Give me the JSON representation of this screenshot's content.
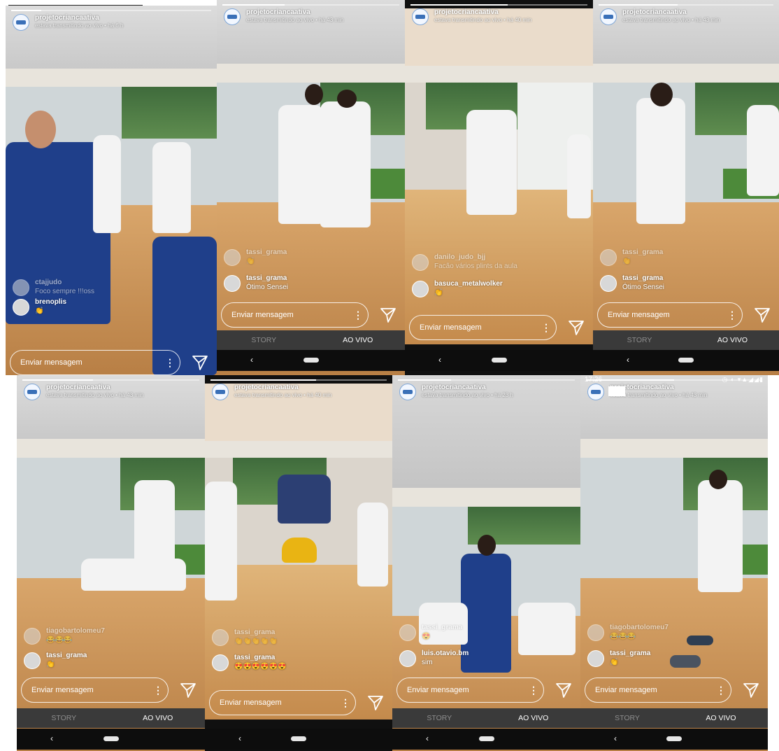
{
  "panels": [
    {
      "username": "projetocriancaativa",
      "status": "estava transmitindo ao vivo • há 6 h",
      "progress": 0.15,
      "comments": [
        {
          "user": "ctajjudo",
          "text": "Foco sempre !!!oss",
          "faded": true
        },
        {
          "user": "brenoplis",
          "text": "👏",
          "faded": false
        }
      ],
      "placeholder": "Enviar mensagem",
      "has_tabs": false
    },
    {
      "username": "projetocriancaativa",
      "status": "estava transmitindo ao vivo • há 43 min",
      "progress": 0.35,
      "comments": [
        {
          "user": "tassi_grama",
          "text": "👏",
          "faded": true
        },
        {
          "user": "tassi_grama",
          "text": "Ótimo Sensei",
          "faded": false
        }
      ],
      "placeholder": "Enviar mensagem",
      "has_tabs": true,
      "tab_story": "STORY",
      "tab_live": "AO VIVO"
    },
    {
      "username": "projetocriancaativa",
      "status": "estava transmitindo ao vivo • há 40 min",
      "progress": 0.55,
      "comments": [
        {
          "user": "danilo_judo_bjj",
          "text": "Facão vários plints da aula",
          "faded": true
        },
        {
          "user": "basuca_metalwolker",
          "text": "👏",
          "faded": false
        }
      ],
      "placeholder": "Enviar mensagem",
      "has_tabs": false
    },
    {
      "username": "projetocriancaativa",
      "status": "estava transmitindo ao vivo • há 43 min",
      "progress": 0.45,
      "comments": [
        {
          "user": "tassi_grama",
          "text": "👏",
          "faded": true
        },
        {
          "user": "tassi_grama",
          "text": "Ótimo Sensei",
          "faded": false
        }
      ],
      "placeholder": "Enviar mensagem",
      "has_tabs": true,
      "tab_story": "STORY",
      "tab_live": "AO VIVO"
    },
    {
      "username": "projetocriancaativa",
      "status": "estava transmitindo ao vivo • há 43 min",
      "progress": 0.4,
      "comments": [
        {
          "user": "tiagobartolomeu7",
          "text": "😂😂😂",
          "faded": true
        },
        {
          "user": "tassi_grama",
          "text": "👏",
          "faded": false
        }
      ],
      "placeholder": "Enviar mensagem",
      "has_tabs": true,
      "tab_story": "STORY",
      "tab_live": "AO VIVO"
    },
    {
      "username": "projetocriancaativa",
      "status": "estava transmitindo ao vivo • há 40 min",
      "progress": 0.6,
      "comments": [
        {
          "user": "tassi_grama",
          "text": "👏👏👏👏👏",
          "faded": true
        },
        {
          "user": "tassi_grama",
          "text": "😍😍😍😍😍😍",
          "faded": false
        }
      ],
      "placeholder": "Enviar mensagem",
      "has_tabs": false
    },
    {
      "username": "projetocriancaativa",
      "status": "estava transmitindo ao vivo • há 23 h",
      "progress": 0.3,
      "comments": [
        {
          "user": "tassi_grama",
          "text": "😍",
          "faded": true
        },
        {
          "user": "luis.otavio.bm",
          "text": "sim",
          "faded": false
        }
      ],
      "placeholder": "Enviar mensagem",
      "has_tabs": true,
      "tab_story": "STORY",
      "tab_live": "AO VIVO"
    },
    {
      "username": "projetocriancaativa",
      "status": "estava transmitindo ao vivo • há 43 min",
      "progress": 0.5,
      "system_time": "17:26",
      "comments": [
        {
          "user": "tiagobartolomeu7",
          "text": "😂😂😂",
          "faded": true
        },
        {
          "user": "tassi_grama",
          "text": "👏",
          "faded": false
        }
      ],
      "placeholder": "Enviar mensagem",
      "has_tabs": true,
      "tab_story": "STORY",
      "tab_live": "AO VIVO"
    }
  ],
  "nav": {
    "back_icon": "chevron-left-icon",
    "home_icon": "home-pill-icon"
  },
  "colors": {
    "mat": "#c88f52",
    "tab_bar": "#3a3a3a",
    "nav_bar": "#0d0d0d",
    "gi_blue": "#1f3f8a",
    "gi_white": "#f3f3f3"
  }
}
